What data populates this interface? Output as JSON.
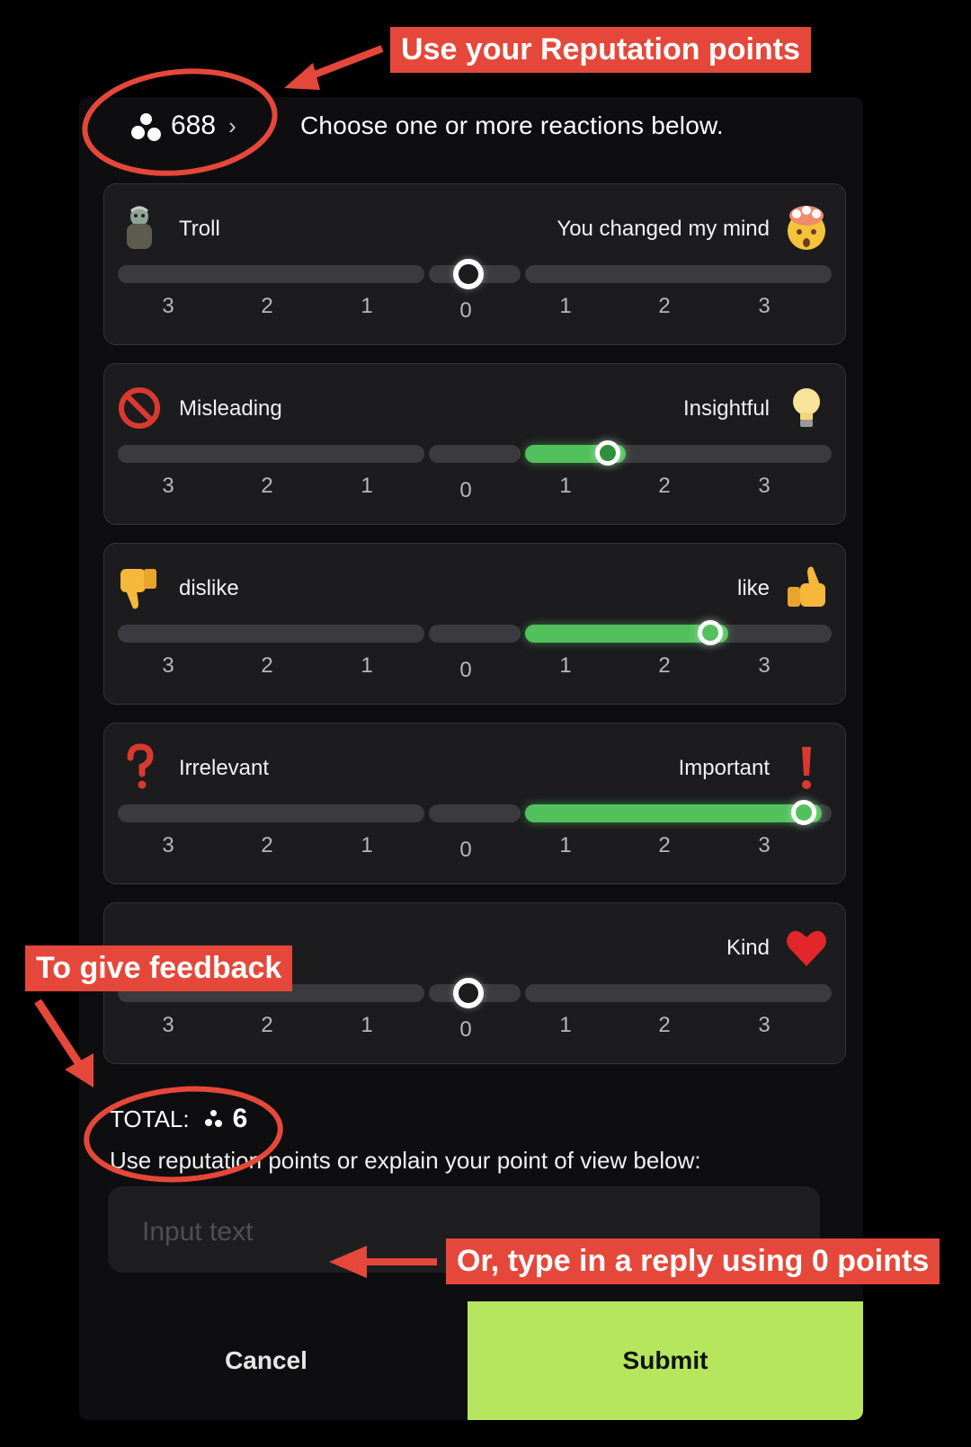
{
  "header": {
    "balance": "688",
    "chevron": "›",
    "instruction": "Choose one or more reactions below."
  },
  "reactions": [
    {
      "left_label": "Troll",
      "right_label": "You changed my mind",
      "left_icon": "troll-emoji",
      "right_icon": "mind-blown-emoji",
      "value": 0
    },
    {
      "left_label": "Misleading",
      "right_label": "Insightful",
      "left_icon": "prohibited-emoji",
      "right_icon": "lightbulb-emoji",
      "value": 1
    },
    {
      "left_label": "dislike",
      "right_label": "like",
      "left_icon": "thumbs-down-emoji",
      "right_icon": "thumbs-up-emoji",
      "value": 2
    },
    {
      "left_label": "Irrelevant",
      "right_label": "Important",
      "left_icon": "question-mark-emoji",
      "right_icon": "exclamation-mark-emoji",
      "value": 3
    },
    {
      "left_label": "",
      "right_label": "Kind",
      "left_icon": "",
      "right_icon": "heart-emoji",
      "value": 0
    }
  ],
  "scale": [
    "3",
    "2",
    "1",
    "0",
    "1",
    "2",
    "3"
  ],
  "total": {
    "label": "TOTAL:",
    "value": "6"
  },
  "hint": "Use reputation points or explain your point of view below:",
  "input": {
    "placeholder": "Input text"
  },
  "buttons": {
    "cancel": "Cancel",
    "submit": "Submit"
  },
  "annotations": {
    "reputation": "Use your Reputation points",
    "feedback": "To give feedback",
    "reply": "Or, type in a reply using 0 points"
  },
  "colors": {
    "accent_green": "#52c15b",
    "submit_bg": "#b5e65d",
    "annotation_red": "#e5483a"
  }
}
